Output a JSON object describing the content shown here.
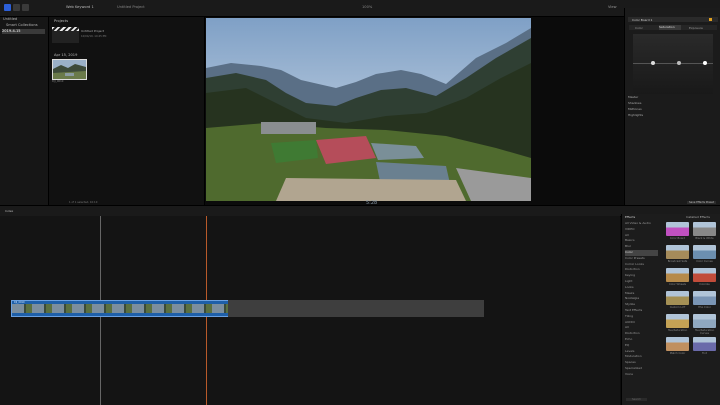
{
  "toolbar": {
    "library_name": "Web Keyword 1",
    "project_name": "Untitled Project",
    "zoom": "100%",
    "view_label": "View",
    "timecode": "5:28",
    "browser_count": "1 of 1 selected, 10:10"
  },
  "sidebar": {
    "items": [
      {
        "label": "Untitled"
      },
      {
        "label": "Smart Collections"
      },
      {
        "label": "2019-4-15"
      }
    ]
  },
  "browser": {
    "section_project": "Projects",
    "project_clip": {
      "name": "Untitled Project",
      "meta": "10/04/19, 10:45 PM"
    },
    "date_header": "Apr 15, 2019",
    "clip": {
      "name": "DJI_0010"
    }
  },
  "inspector": {
    "title": "Color Board 1",
    "tabs": [
      "Color",
      "Saturation",
      "Exposure"
    ],
    "rows": [
      "Master",
      "Shadows",
      "Midtones",
      "Highlights"
    ],
    "save_label": "Save Effects Preset"
  },
  "timeline": {
    "index_label": "Index",
    "clip_name": "DJI_0010"
  },
  "effects": {
    "title": "Effects",
    "header": "Installed Effects",
    "categories": [
      "All Video & Audio",
      "VIDEO",
      "All",
      "Basics",
      "Blur",
      "Color",
      "Color Presets",
      "Comic Looks",
      "Distortion",
      "Keying",
      "Light",
      "Looks",
      "Masks",
      "Nostalgia",
      "Stylize",
      "Text Effects",
      "Tiling",
      "AUDIO",
      "All",
      "Distortion",
      "Echo",
      "EQ",
      "Levels",
      "Modulation",
      "Spaces",
      "Specialized",
      "Voice"
    ],
    "selected_index": 5,
    "thumbs": [
      {
        "label": "Color Board",
        "color": "#c050c0"
      },
      {
        "label": "Black & White",
        "color": "#888888"
      },
      {
        "label": "Broadcast Safe",
        "color": "#a58b5a"
      },
      {
        "label": "Color Curves",
        "color": "#6c8fb0"
      },
      {
        "label": "Color Wheels",
        "color": "#b68a4a"
      },
      {
        "label": "Colorize",
        "color": "#c24c3a"
      },
      {
        "label": "Custom LUT",
        "color": "#a49055"
      },
      {
        "label": "HSL Color",
        "color": "#7a95b5"
      },
      {
        "label": "Hue/Saturation",
        "color": "#c4a255"
      },
      {
        "label": "Hue/Saturation Curves",
        "color": "#8fa8c0"
      },
      {
        "label": "Match Color",
        "color": "#c09060"
      },
      {
        "label": "Tint",
        "color": "#6a6aaa"
      }
    ],
    "search_placeholder": "Search"
  }
}
